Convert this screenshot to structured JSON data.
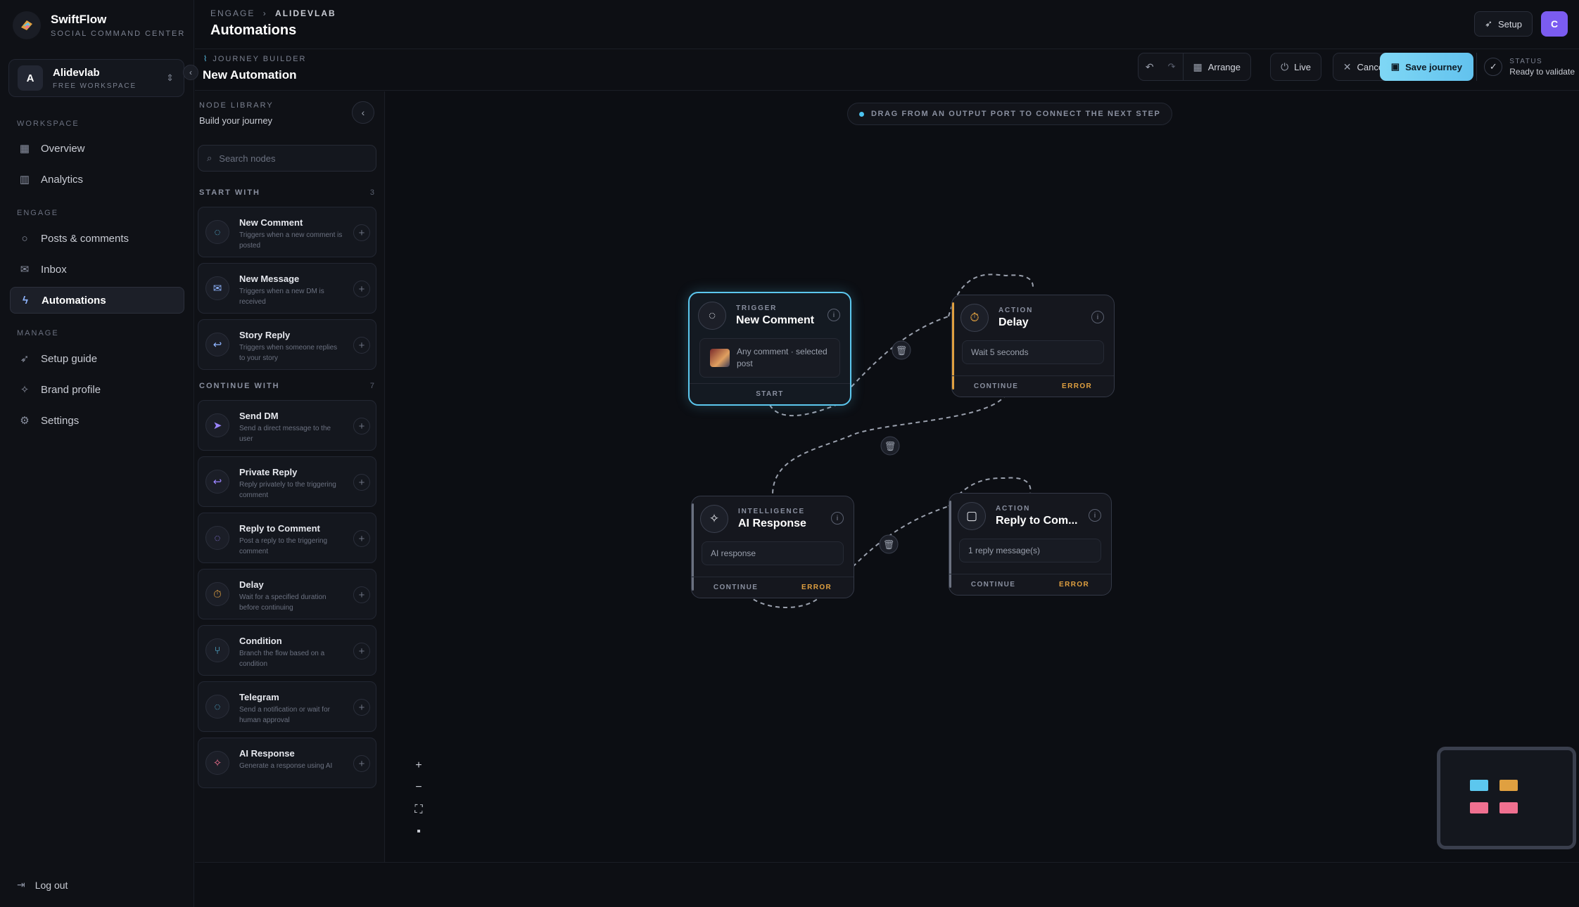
{
  "brand": {
    "name": "SwiftFlow",
    "tagline": "SOCIAL COMMAND CENTER"
  },
  "workspace": {
    "avatar": "A",
    "name": "Alidevlab",
    "plan": "FREE WORKSPACE",
    "toggle_icon": "chevron-updown-icon"
  },
  "sidebar": {
    "sections": [
      "WORKSPACE",
      "ENGAGE",
      "MANAGE"
    ],
    "items": [
      {
        "label": "Overview",
        "icon": "grid-icon"
      },
      {
        "label": "Analytics",
        "icon": "bar-chart-icon"
      },
      {
        "label": "Posts & comments",
        "icon": "chat-icon"
      },
      {
        "label": "Inbox",
        "icon": "inbox-icon"
      },
      {
        "label": "Automations",
        "icon": "bolt-icon",
        "active": true
      },
      {
        "label": "Setup guide",
        "icon": "rocket-icon"
      },
      {
        "label": "Brand profile",
        "icon": "sparkle-icon"
      },
      {
        "label": "Settings",
        "icon": "gear-icon"
      }
    ],
    "logout": "Log out"
  },
  "header": {
    "breadcrumb": [
      "ENGAGE",
      "ALIDEVLAB"
    ],
    "title": "Automations",
    "setup_label": "Setup",
    "user_initial": "C"
  },
  "builder": {
    "label": "JOURNEY BUILDER",
    "title": "New Automation",
    "arrange_label": "Arrange",
    "live_label": "Live",
    "cancel_label": "Cancel",
    "save_label": "Save journey",
    "status_label": "STATUS",
    "status_value": "Ready to validate"
  },
  "library": {
    "label": "NODE LIBRARY",
    "subtitle": "Build your journey",
    "search_placeholder": "Search nodes",
    "start_section": {
      "title": "START WITH",
      "count": "3"
    },
    "continue_section": {
      "title": "CONTINUE WITH",
      "count": "7"
    },
    "start_items": [
      {
        "name": "New Comment",
        "desc": "Triggers when a new comment is posted",
        "icon": "comment-icon",
        "color": "#5cc7ee"
      },
      {
        "name": "New Message",
        "desc": "Triggers when a new DM is received",
        "icon": "mail-icon",
        "color": "#8fb5ff"
      },
      {
        "name": "Story Reply",
        "desc": "Triggers when someone replies to your story",
        "icon": "reply-icon",
        "color": "#8fb5ff"
      }
    ],
    "continue_items": [
      {
        "name": "Send DM",
        "desc": "Send a direct message to the user",
        "icon": "send-icon",
        "color": "#9b85ff"
      },
      {
        "name": "Private Reply",
        "desc": "Reply privately to the triggering comment",
        "icon": "reply-icon",
        "color": "#9b85ff"
      },
      {
        "name": "Reply to Comment",
        "desc": "Post a reply to the triggering comment",
        "icon": "comment-icon",
        "color": "#9b85ff"
      },
      {
        "name": "Delay",
        "desc": "Wait for a specified duration before continuing",
        "icon": "timer-icon",
        "color": "#e0a040"
      },
      {
        "name": "Condition",
        "desc": "Branch the flow based on a condition",
        "icon": "branch-icon",
        "color": "#5cc7ee"
      },
      {
        "name": "Telegram",
        "desc": "Send a notification or wait for human approval",
        "icon": "telegram-icon",
        "color": "#5cc7ee"
      },
      {
        "name": "AI Response",
        "desc": "Generate a response using AI",
        "icon": "sparkle-icon",
        "color": "#f07090"
      }
    ]
  },
  "canvas": {
    "hint": "DRAG FROM AN OUTPUT PORT TO CONNECT THE NEXT STEP",
    "nodes": {
      "trigger": {
        "kind": "TRIGGER",
        "title": "New Comment",
        "body": "Any comment · selected post",
        "port": "START"
      },
      "delay": {
        "kind": "ACTION",
        "title": "Delay",
        "body": "Wait 5 seconds",
        "continue": "CONTINUE",
        "error": "ERROR"
      },
      "ai": {
        "kind": "INTELLIGENCE",
        "title": "AI Response",
        "body": "AI response",
        "continue": "CONTINUE",
        "error": "ERROR"
      },
      "reply": {
        "kind": "ACTION",
        "title": "Reply to Com...",
        "body": "1 reply message(s)",
        "continue": "CONTINUE",
        "error": "ERROR"
      }
    },
    "colors": {
      "trigger": "#5cc7ee",
      "action": "#e0a040",
      "intelligence": "#9aa0ad",
      "ai": "#f07090"
    }
  }
}
